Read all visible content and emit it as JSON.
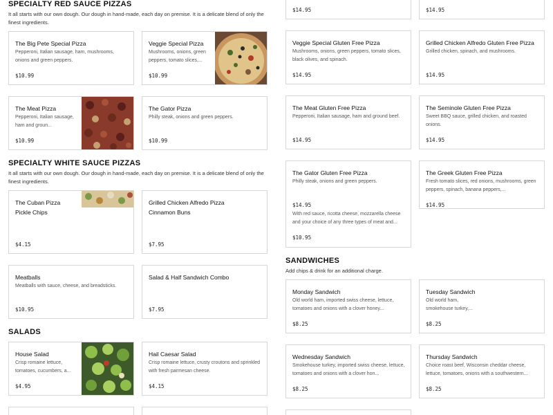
{
  "red_sauce": {
    "title": "SPECIALTY RED SAUCE PIZZAS",
    "description": "It all starts with our own dough. Our dough in hand-made, each day on premise. It is a delicate blend of only the finest ingredients.",
    "items": [
      {
        "name": "The Big Pete Special Pizza",
        "desc": "Pepperoni, Italian sausage, ham, mushrooms, onions and green peppers.",
        "price": "$10.99"
      },
      {
        "name": "Veggie Special Pizza",
        "desc": "Mushrooms, onions, green peppers, tomato slices,...",
        "price": "$10.99",
        "image": "veggie-pizza-photo"
      },
      {
        "name": "The Meat Pizza",
        "desc": "Pepperoni, Italian sausage, ham and groun...",
        "price": "$10.99",
        "image": "meat-pizza-photo"
      },
      {
        "name": "The Gator Pizza",
        "desc": "Philly steak, onions and green peppers.",
        "price": "$10.99"
      }
    ]
  },
  "white_sauce": {
    "title": "SPECIALTY WHITE SAUCE PIZZAS",
    "description": "It all starts with our own dough. Our dough in hand-made, each day on premise. It is a delicate blend of only the finest ingredients.",
    "items": [
      {
        "name": "The Cuban Pizza",
        "name2": "Pickle Chips",
        "price": "$4.15",
        "image": "cuban-pizza-photo"
      },
      {
        "name": "Grilled Chicken Alfredo Pizza",
        "name2": "Cinnamon Buns",
        "price": "$7.95"
      },
      {
        "name": "Meatballs",
        "desc": "Meatballs with sauce, cheese, and breadsticks.",
        "price": "$10.95"
      },
      {
        "name": "Salad & Half Sandwich Combo",
        "price": "$7.95"
      }
    ]
  },
  "salads": {
    "title": "SALADS",
    "items": [
      {
        "name": "House Salad",
        "desc": "Crisp romaine lettuce, tomatoes, cucumbers, a...",
        "price": "$4.95",
        "image": "house-salad-photo"
      },
      {
        "name": "Hail Caesar Salad",
        "desc": "Crisp romaine lettuce, crusty croutons and sprinkled with fresh parmesan cheese.",
        "price": "$4.15"
      }
    ]
  },
  "gluten_free": {
    "top_prices": [
      "$14.95",
      "$14.95"
    ],
    "items": [
      {
        "name": "Veggie Special Gluten Free Pizza",
        "desc": "Mushrooms, onions, green peppers, tomato slices, black olives, and spinach.",
        "price": "$14.95"
      },
      {
        "name": "Grilled Chicken Alfredo Gluten Free Pizza",
        "desc": "Grilled chicken, spinach, and mushrooms.",
        "price": "$14.95"
      },
      {
        "name": "The Meat Gluten Free Pizza",
        "desc": "Pepperoni, Italian sausage, ham and ground beef.",
        "price": "$14.95"
      },
      {
        "name": "The Seminole Gluten Free Pizza",
        "desc": "Sweet BBQ sauce, grilled chicken, and roasted onions.",
        "price": "$14.95"
      },
      {
        "name": "The Gator Gluten Free Pizza",
        "desc": "Philly steak, onions and green peppers.",
        "price": "$14.95"
      },
      {
        "name": "The Greek Gluten Free Pizza",
        "desc": "Fresh tomato slices, red onions, mushrooms, green peppers, spinach, banana peppers,...",
        "price": "$14.95"
      }
    ],
    "overlay": {
      "desc": "With red sauce, ricotta cheese, mozzarella cheese and your choice of any three types of meat and...",
      "price": "$10.95"
    }
  },
  "sandwiches": {
    "title": "SANDWICHES",
    "description": "Add chips & drink for an additional charge.",
    "items": [
      {
        "name": "Monday Sandwich",
        "desc": "Old world ham, imported swiss cheese, lettuce, tomatoes and onions with a clover honey...",
        "price": "$8.25"
      },
      {
        "name": "Tuesday Sandwich",
        "desc": "Old world ham, smokehouse turkey,...",
        "price": "$8.25"
      },
      {
        "name": "Wednesday Sandwich",
        "desc": "Smokehouse turkey, imported swiss cheese, lettuce, tomatoes and onions with a clover hon...",
        "price": "$8.25"
      },
      {
        "name": "Thursday Sandwich",
        "desc": "Choice roast beef, Wisconsin cheddar cheese, lettuce, tomatoes, onions with a southwestern...",
        "price": "$8.25"
      }
    ]
  }
}
